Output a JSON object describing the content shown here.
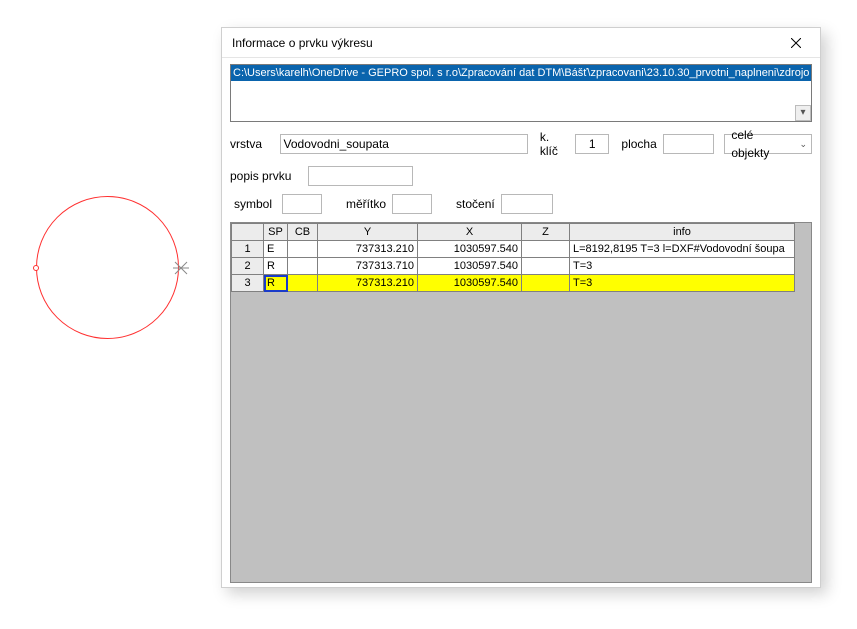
{
  "window": {
    "title": "Informace o prvku výkresu",
    "path": "C:\\Users\\karelh\\OneDrive - GEPRO spol. s r.o\\Zpracování dat DTM\\Bášť\\zpracovani\\23.10.30_prvotni_naplneni\\zdrojo"
  },
  "form": {
    "vrstva_label": "vrstva",
    "vrstva_value": "Vodovodni_soupata",
    "kklic_label": "k. klíč",
    "kklic_value": "1",
    "plocha_label": "plocha",
    "plocha_value": "",
    "scope_label": "celé objekty",
    "popis_label": "popis prvku",
    "popis_value": "",
    "symbol_label": "symbol",
    "symbol_value": "",
    "meritko_label": "měřítko",
    "meritko_value": "",
    "stoceni_label": "stočení",
    "stoceni_value": ""
  },
  "grid": {
    "headers": {
      "corner": "",
      "sp": "SP",
      "cb": "CB",
      "y": "Y",
      "x": "X",
      "z": "Z",
      "info": "info"
    },
    "rows": [
      {
        "n": "1",
        "sp": "E",
        "cb": "",
        "y": "737313.210",
        "x": "1030597.540",
        "z": "",
        "info": "L=8192,8195 T=3 l=DXF#Vodovodní šoupa"
      },
      {
        "n": "2",
        "sp": "R",
        "cb": "",
        "y": "737313.710",
        "x": "1030597.540",
        "z": "",
        "info": "T=3"
      },
      {
        "n": "3",
        "sp": "R",
        "cb": "",
        "y": "737313.210",
        "x": "1030597.540",
        "z": "",
        "info": "T=3"
      }
    ]
  }
}
